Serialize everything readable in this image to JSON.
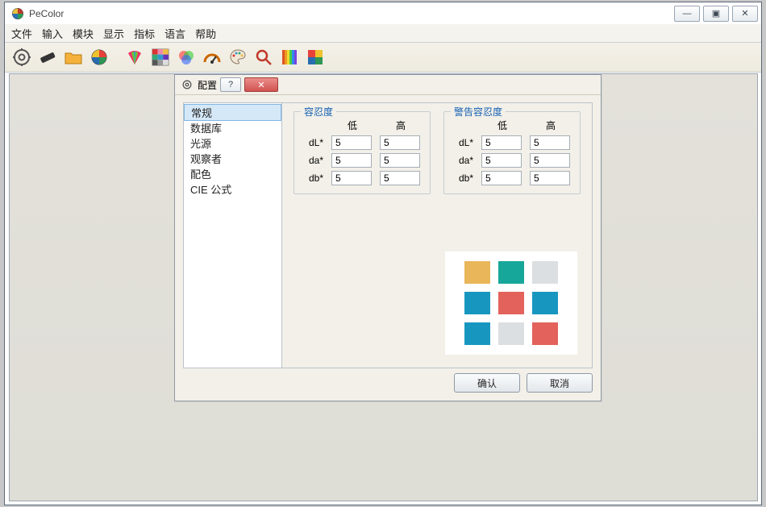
{
  "app": {
    "title": "PeColor"
  },
  "menubar": [
    "文件",
    "输入",
    "模块",
    "显示",
    "指标",
    "语言",
    "帮助"
  ],
  "toolbar_icons": [
    "settings-gear-icon",
    "eraser-icon",
    "open-folder-icon",
    "color-wheel-icon",
    "fan-chart-icon",
    "color-grid-icon",
    "venn-icon",
    "gauge-icon",
    "palette-icon",
    "search-icon",
    "spectrum-icon",
    "mosaic-icon"
  ],
  "dialog": {
    "title": "配置",
    "sidebar": [
      "常规",
      "数据库",
      "光源",
      "观察者",
      "配色",
      "CIE 公式"
    ],
    "selected_sidebar_index": 0,
    "tolerance": {
      "title": "容忍度",
      "cols": {
        "low": "低",
        "high": "高"
      },
      "rows": [
        {
          "label": "dL*",
          "low": "5",
          "high": "5"
        },
        {
          "label": "da*",
          "low": "5",
          "high": "5"
        },
        {
          "label": "db*",
          "low": "5",
          "high": "5"
        }
      ]
    },
    "warning_tolerance": {
      "title": "警告容忍度",
      "cols": {
        "low": "低",
        "high": "高"
      },
      "rows": [
        {
          "label": "dL*",
          "low": "5",
          "high": "5"
        },
        {
          "label": "da*",
          "low": "5",
          "high": "5"
        },
        {
          "label": "db*",
          "low": "5",
          "high": "5"
        }
      ]
    },
    "swatch_colors": [
      "#e9b65a",
      "#17a79a",
      "#dcdfe1",
      "#1797bf",
      "#e3625c",
      "#1797bf",
      "#1797bf",
      "#dcdfe1",
      "#e3625c"
    ],
    "buttons": {
      "ok": "确认",
      "cancel": "取消"
    }
  }
}
